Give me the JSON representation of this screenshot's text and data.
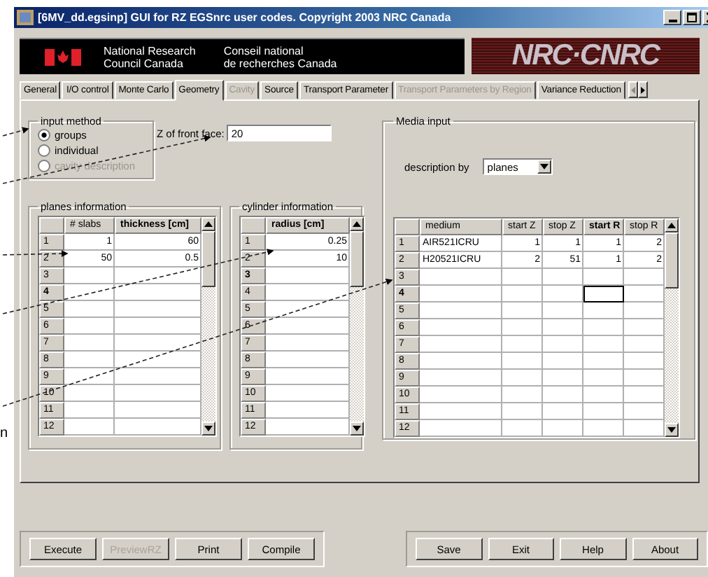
{
  "window": {
    "title": "[6MV_dd.egsinp] GUI for RZ EGSnrc user codes. Copyright 2003 NRC Canada"
  },
  "banner": {
    "english": [
      "National Research",
      "Council Canada"
    ],
    "french": [
      "Conseil national",
      "de recherches Canada"
    ],
    "logo": "NRC·CNRC"
  },
  "tabs": [
    {
      "label": "General",
      "selected": false,
      "disabled": false
    },
    {
      "label": "I/O control",
      "selected": false,
      "disabled": false
    },
    {
      "label": "Monte Carlo",
      "selected": false,
      "disabled": false
    },
    {
      "label": "Geometry",
      "selected": true,
      "disabled": false
    },
    {
      "label": "Cavity",
      "selected": false,
      "disabled": true
    },
    {
      "label": "Source",
      "selected": false,
      "disabled": false
    },
    {
      "label": "Transport Parameter",
      "selected": false,
      "disabled": false
    },
    {
      "label": "Transport Parameters by Region",
      "selected": false,
      "disabled": true
    },
    {
      "label": "Variance Reduction",
      "selected": false,
      "disabled": false
    }
  ],
  "input_method": {
    "title": "input method",
    "options": [
      {
        "label": "groups",
        "selected": true,
        "disabled": false
      },
      {
        "label": "individual",
        "selected": false,
        "disabled": false
      },
      {
        "label": "cavity description",
        "selected": false,
        "disabled": true
      }
    ]
  },
  "z_front_face": {
    "label": "Z of front face:",
    "value": "20"
  },
  "planes_information": {
    "title": "planes information",
    "columns": [
      {
        "label": "# slabs",
        "current": false
      },
      {
        "label": "thickness [cm]",
        "current": true
      }
    ],
    "rows": [
      {
        "label": "1",
        "current": false,
        "cells": [
          "1",
          "60"
        ]
      },
      {
        "label": "2",
        "current": false,
        "cells": [
          "50",
          "0.5"
        ]
      },
      {
        "label": "3",
        "current": false
      },
      {
        "label": "4",
        "current": true
      },
      {
        "label": "5",
        "current": false
      },
      {
        "label": "6",
        "current": false
      },
      {
        "label": "7",
        "current": false
      },
      {
        "label": "8",
        "current": false
      },
      {
        "label": "9",
        "current": false
      },
      {
        "label": "10",
        "current": false
      },
      {
        "label": "11",
        "current": false
      },
      {
        "label": "12",
        "current": false
      }
    ]
  },
  "cylinder_information": {
    "title": "cylinder information",
    "columns": [
      {
        "label": "radius [cm]",
        "current": true
      }
    ],
    "rows": [
      {
        "label": "1",
        "current": false,
        "cells": [
          "0.25"
        ]
      },
      {
        "label": "2",
        "current": false,
        "cells": [
          "10"
        ]
      },
      {
        "label": "3",
        "current": true
      },
      {
        "label": "4",
        "current": false
      },
      {
        "label": "5",
        "current": false
      },
      {
        "label": "6",
        "current": false
      },
      {
        "label": "7",
        "current": false
      },
      {
        "label": "8",
        "current": false
      },
      {
        "label": "9",
        "current": false
      },
      {
        "label": "10",
        "current": false
      },
      {
        "label": "11",
        "current": false
      },
      {
        "label": "12",
        "current": false
      }
    ]
  },
  "media_input": {
    "title": "Media input",
    "description_by": {
      "label": "description by",
      "value": "planes"
    },
    "columns": [
      {
        "label": "medium",
        "current": false
      },
      {
        "label": "start Z",
        "current": false
      },
      {
        "label": "stop Z",
        "current": false
      },
      {
        "label": "start R",
        "current": true
      },
      {
        "label": "stop R",
        "current": false
      }
    ],
    "rows": [
      {
        "label": "1",
        "current": false,
        "cells": [
          "AIR521ICRU",
          "1",
          "1",
          "1",
          "2"
        ]
      },
      {
        "label": "2",
        "current": false,
        "cells": [
          "H20521ICRU",
          "2",
          "51",
          "1",
          "2"
        ]
      },
      {
        "label": "3",
        "current": false
      },
      {
        "label": "4",
        "current": true
      },
      {
        "label": "5",
        "current": false
      },
      {
        "label": "6",
        "current": false
      },
      {
        "label": "7",
        "current": false
      },
      {
        "label": "8",
        "current": false
      },
      {
        "label": "9",
        "current": false
      },
      {
        "label": "10",
        "current": false
      },
      {
        "label": "11",
        "current": false
      },
      {
        "label": "12",
        "current": false
      }
    ]
  },
  "run_buttons": [
    {
      "label": "Execute",
      "disabled": false
    },
    {
      "label": "PreviewRZ",
      "disabled": true
    },
    {
      "label": "Print",
      "disabled": false
    },
    {
      "label": "Compile",
      "disabled": false
    }
  ],
  "file_buttons": [
    {
      "label": "Save",
      "disabled": false
    },
    {
      "label": "Exit",
      "disabled": false
    },
    {
      "label": "Help",
      "disabled": false
    },
    {
      "label": "About",
      "disabled": false
    }
  ],
  "annotation_fragment": "n"
}
